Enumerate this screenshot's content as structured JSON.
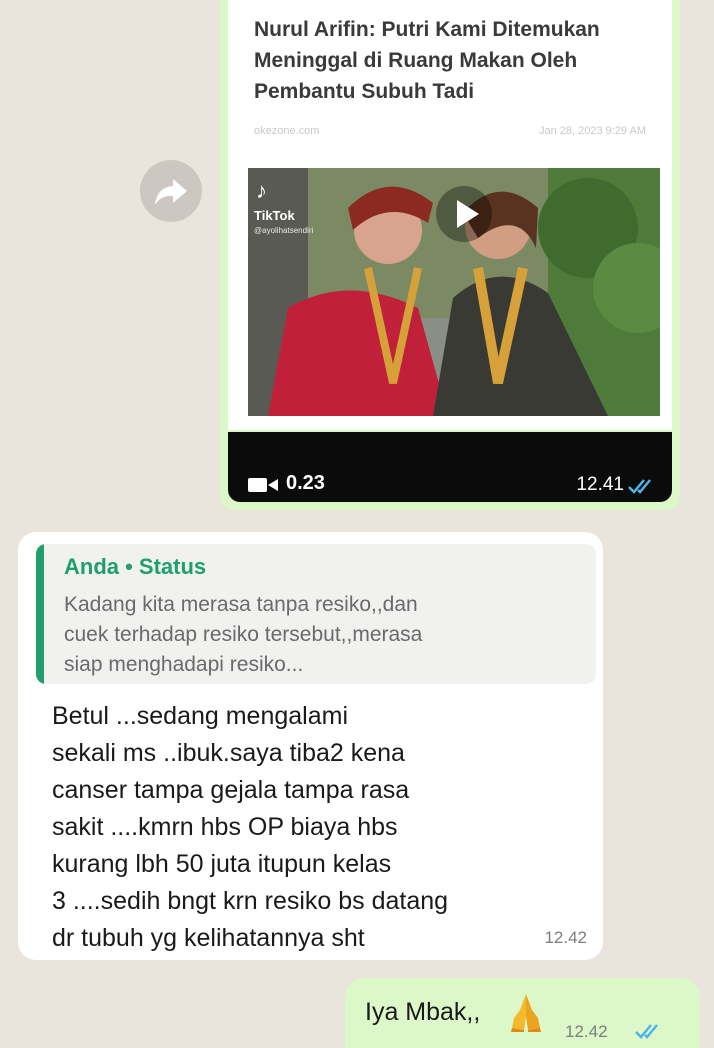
{
  "top_message": {
    "link_card": {
      "title": "Nurul Arifin: Putri Kami Ditemukan Meninggal di Ruang Makan Oleh Pembantu Subuh Tadi",
      "source": "okezone.com",
      "date": "Jan 28, 2023 9:29 AM"
    },
    "video": {
      "watermark": "TikTok",
      "username": "@ayolihatsendiri",
      "duration": "0.23",
      "time": "12.41"
    },
    "icons": {
      "forward": "forward-icon",
      "camera": "videocam-icon",
      "ticks": "double-check-icon"
    },
    "colors": {
      "bubble": "#dcf7c8",
      "read_ticks": "#4fb3e8"
    }
  },
  "reply_message": {
    "quote": {
      "author": "Anda • Status",
      "text": "Kadang kita merasa tanpa resiko,,dan\ncuek terhadap resiko tersebut,,merasa\nsiap menghadapi resiko..."
    },
    "text": "Betul ...sedang mengalami\nsekali ms ..ibuk.saya tiba2 kena\ncanser tampa gejala tampa rasa\nsakit ....kmrn hbs OP biaya hbs\nkurang lbh 50 juta itupun kelas\n3 ....sedih bngt krn resiko bs datang\ndr tubuh yg kelihatannya sht",
    "time": "12.42",
    "colors": {
      "quote_accent": "#1f9f70"
    }
  },
  "bottom_message": {
    "text": "Iya Mbak,,",
    "emoji_icon": "folded-hands-icon",
    "time": "12.42"
  }
}
